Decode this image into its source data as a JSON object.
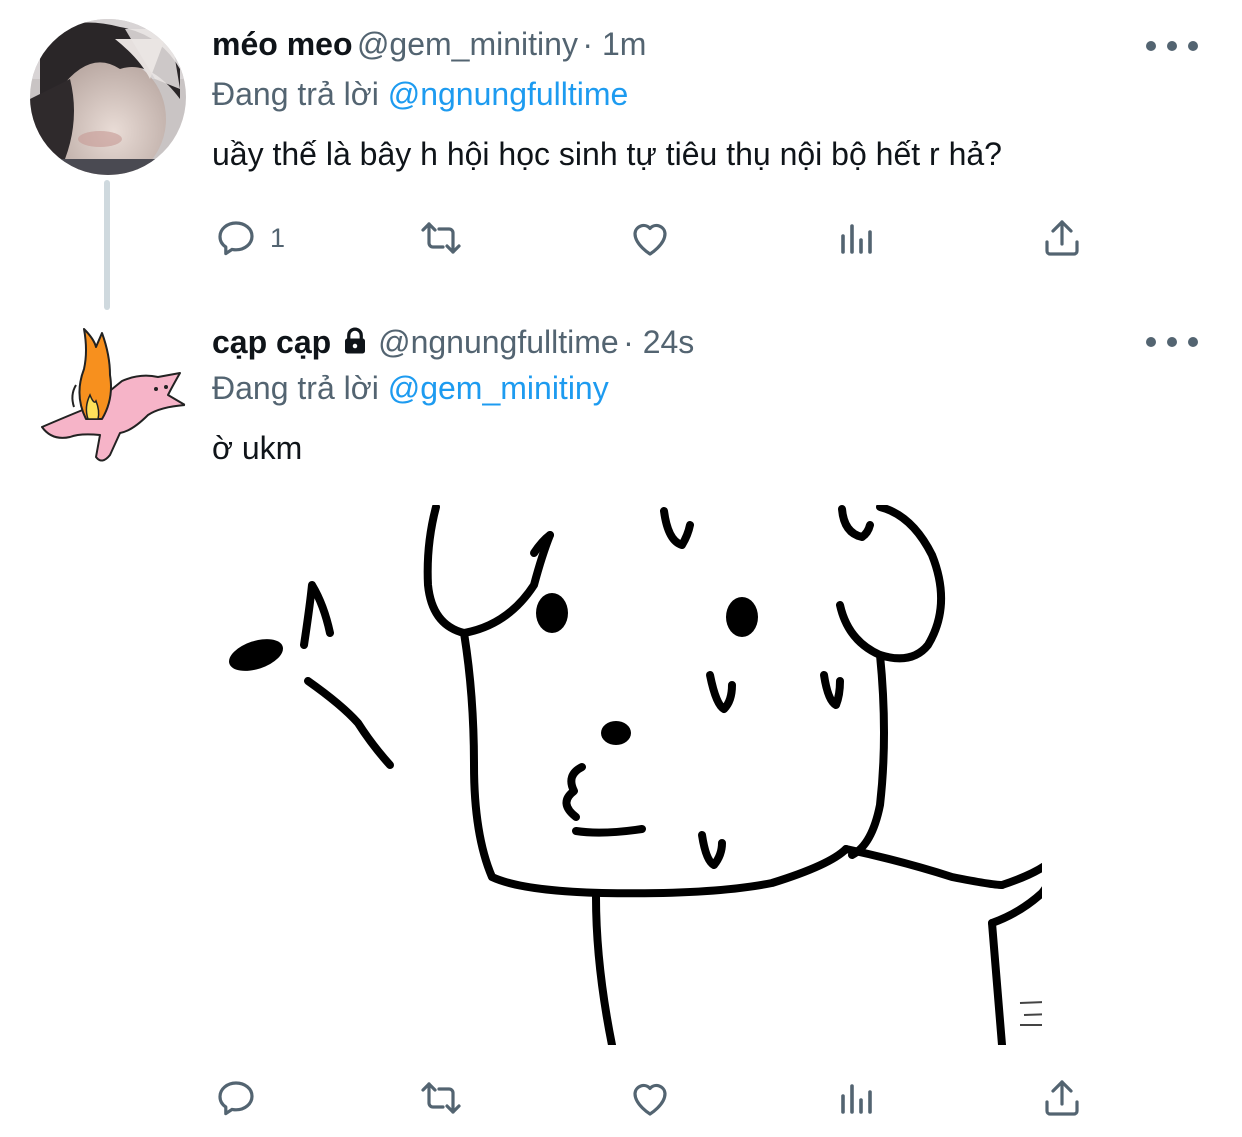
{
  "tweets": [
    {
      "name": "méo meo",
      "handle": "@gem_minitiny",
      "time": "· 1m",
      "reply_label": "Đang trả lời",
      "reply_mention": "@ngnungfulltime",
      "text": "uầy thế là bây h hội học sinh tự tiêu thụ nội bộ hết r hả?",
      "reply_count": "1",
      "avatar": "profile-photo-person"
    },
    {
      "name": "cạp cạp",
      "handle": "@ngnungfulltime",
      "time": "· 24s",
      "reply_label": "Đang trả lời",
      "reply_mention": "@gem_minitiny",
      "text": "ờ ukm",
      "reply_count": "",
      "avatar": "cartoon-bunny-with-fire",
      "protected": true,
      "media": "cartoon-sweating-dog-whistling"
    }
  ],
  "icons": [
    "reply-icon",
    "retweet-icon",
    "like-icon",
    "analytics-icon",
    "share-icon",
    "lock-icon",
    "more-icon"
  ],
  "colors": {
    "text": "#0f1419",
    "secondary": "#536471",
    "link": "#1d9bf0",
    "thread_line": "#cfd9de"
  }
}
